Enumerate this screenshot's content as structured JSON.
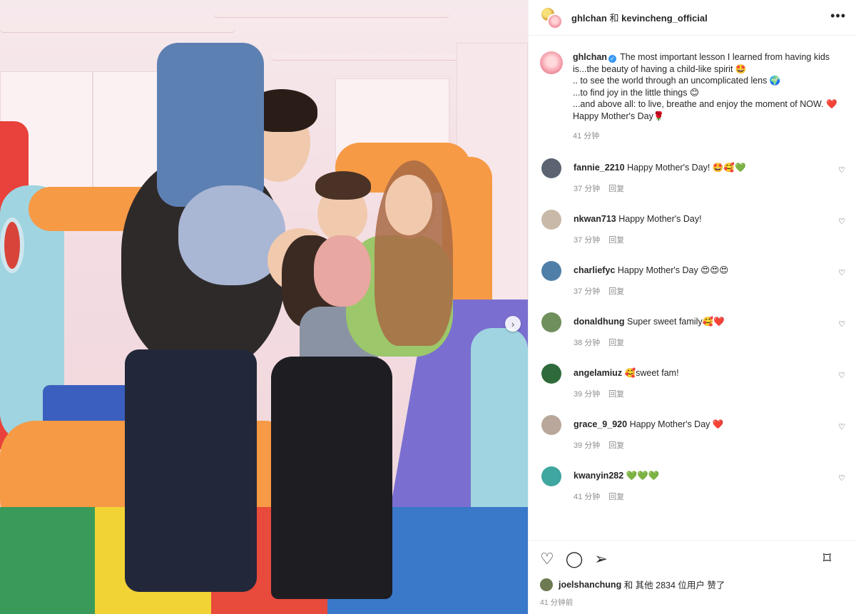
{
  "header": {
    "user1": "ghlchan",
    "and_label": "和",
    "user2": "kevincheng_official"
  },
  "caption": {
    "username": "ghlchan",
    "line1": "The most important lesson I learned from having kids",
    "line2": "is...the beauty of having a child-like spirit 🤩",
    "line3": ".. to see the world through an uncomplicated lens 🌍",
    "line4": "...to find joy in the little things 😊",
    "line5": "...and above all: to live, breathe and enjoy the moment of NOW. ❤️",
    "line6": "Happy Mother's Day🌹",
    "time": "41 分钟"
  },
  "reply_label": "回复",
  "comments": [
    {
      "username": "fannie_2210",
      "text": "Happy Mother's Day! 🤩🥰💚",
      "time": "37 分钟",
      "avatar_color": "#5b6470"
    },
    {
      "username": "nkwan713",
      "text": "Happy Mother's Day!",
      "time": "37 分钟",
      "avatar_color": "#c9b9a8"
    },
    {
      "username": "charliefyc",
      "text": "Happy Mother's Day 😍😍😍",
      "time": "37 分钟",
      "avatar_color": "#4f7fa8"
    },
    {
      "username": "donaldhung",
      "text": "Super sweet family🥰❤️",
      "time": "38 分钟",
      "avatar_color": "#6f8f5c"
    },
    {
      "username": "angelamiuz",
      "text": "🥰sweet fam!",
      "time": "39 分钟",
      "avatar_color": "#2f6b3a"
    },
    {
      "username": "grace_9_920",
      "text": "Happy Mother's Day ❤️",
      "time": "39 分钟",
      "avatar_color": "#b8a79a"
    },
    {
      "username": "kwanyin282",
      "text": "💚💚💚",
      "time": "41 分钟",
      "avatar_color": "#3fa6a0"
    }
  ],
  "likes": {
    "user": "joelshanchung",
    "text": "和 其他 2834 位用户 赞了"
  },
  "posted_time": "41 分钟前",
  "icons": {
    "more": "more-icon",
    "like": "heart-icon",
    "comment": "comment-icon",
    "share": "send-icon",
    "save": "bookmark-icon",
    "next": "chevron-right-icon"
  }
}
